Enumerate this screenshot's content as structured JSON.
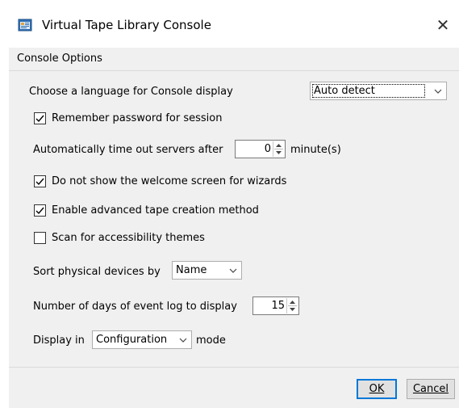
{
  "window": {
    "title": "Virtual Tape Library Console",
    "close_symbol": "✕",
    "icon": "console-app-icon"
  },
  "menu": {
    "console_options": "Console Options"
  },
  "options": {
    "language": {
      "label": "Choose a language for Console display",
      "selected": "Auto detect"
    },
    "remember_password": {
      "label": "Remember password for session",
      "checked": true
    },
    "timeout": {
      "label_before": "Automatically time out servers after",
      "value": "0",
      "label_after": "minute(s)"
    },
    "no_welcome": {
      "label": "Do not show the welcome screen for wizards",
      "checked": true
    },
    "advanced_tape": {
      "label": "Enable advanced tape creation method",
      "checked": true
    },
    "accessibility": {
      "label": "Scan for accessibility themes",
      "checked": false
    },
    "sort_devices": {
      "label": "Sort physical devices by",
      "selected": "Name"
    },
    "event_log_days": {
      "label": "Number of days of event log to display",
      "value": "15"
    },
    "display_mode": {
      "label_before": "Display in",
      "selected": "Configuration",
      "label_after": "mode"
    }
  },
  "buttons": {
    "ok_label": "OK",
    "cancel_label": "Cancel"
  },
  "colors": {
    "dialog_bg": "#f0f0f0",
    "accent": "#0078d7"
  }
}
